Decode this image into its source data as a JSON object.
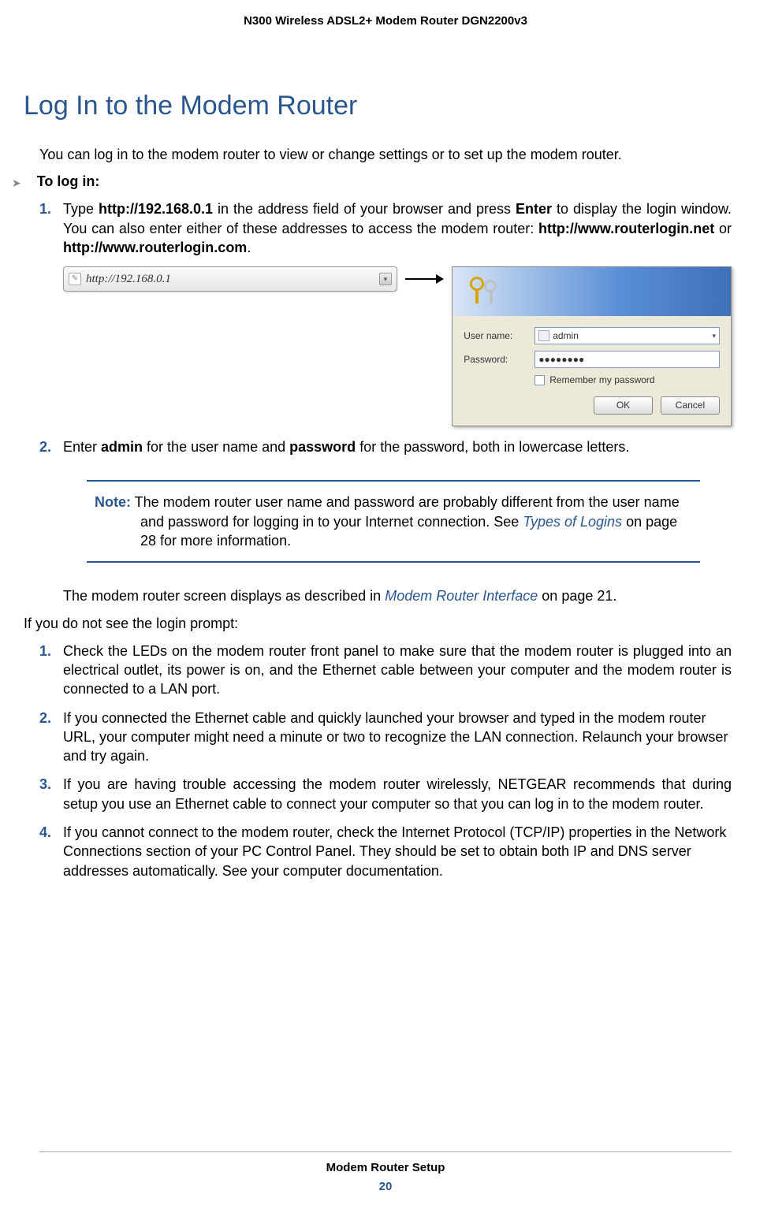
{
  "running_head": "N300 Wireless ADSL2+ Modem Router DGN2200v3",
  "title": "Log In to the Modem Router",
  "intro": "You can log in to the modem router to view or change settings or to set up the modem router.",
  "to_login_label": "To log in:",
  "step1_prefix": "Type ",
  "step1_b1": "http://192.168.0.1",
  "step1_mid1": " in the address field of your browser and press ",
  "step1_b2": "Enter",
  "step1_mid2": " to display the login window. You can also enter either of these addresses to access the modem router: ",
  "step1_b3": "http://www.routerlogin.net",
  "step1_mid3": " or ",
  "step1_b4": "http://www.routerlogin.com",
  "step1_tail": ".",
  "addr_url": "http://192.168.0.1",
  "dlg_user_label": "User name:",
  "dlg_pass_label": "Password:",
  "dlg_user_value": "admin",
  "dlg_pass_value": "●●●●●●●●",
  "dlg_remember": "Remember my password",
  "dlg_ok": "OK",
  "dlg_cancel": "Cancel",
  "step2_prefix": "Enter ",
  "step2_b1": "admin",
  "step2_mid1": " for the user name and ",
  "step2_b2": "password",
  "step2_tail": " for the password, both in lowercase letters.",
  "note_label": "Note:",
  "note_text1": "  The modem router user name and password are probably different from the user name and password for logging in to your Internet connection. See ",
  "note_link": "Types of Logins",
  "note_text2": " on page 28 for more information.",
  "after_note_1": "The modem router screen displays as described in ",
  "after_note_link": "Modem Router Interface",
  "after_note_2": " on page 21.",
  "no_prompt": "If you do not see the login prompt:",
  "ts1": "Check the LEDs on the modem router front panel to make sure that the modem router is plugged into an electrical outlet, its power is on, and the Ethernet cable between your computer and the modem router is connected to a LAN port.",
  "ts2": "If you connected the Ethernet cable and quickly launched your browser and typed in the modem router URL, your computer might need a minute or two to recognize the LAN connection. Relaunch your browser and try again.",
  "ts3": "If you are having trouble accessing the modem router wirelessly, NETGEAR recommends that during setup you use an Ethernet cable to connect your computer so that you can log in to the modem router.",
  "ts4": "If you cannot connect to the modem router, check the Internet Protocol (TCP/IP) properties in the Network Connections section of your PC Control Panel. They should be set to obtain both IP and DNS server addresses automatically. See your computer documentation.",
  "footer_title": "Modem Router Setup",
  "page_number": "20",
  "marker_1": "1.",
  "marker_2": "2.",
  "marker_3": "3.",
  "marker_4": "4."
}
